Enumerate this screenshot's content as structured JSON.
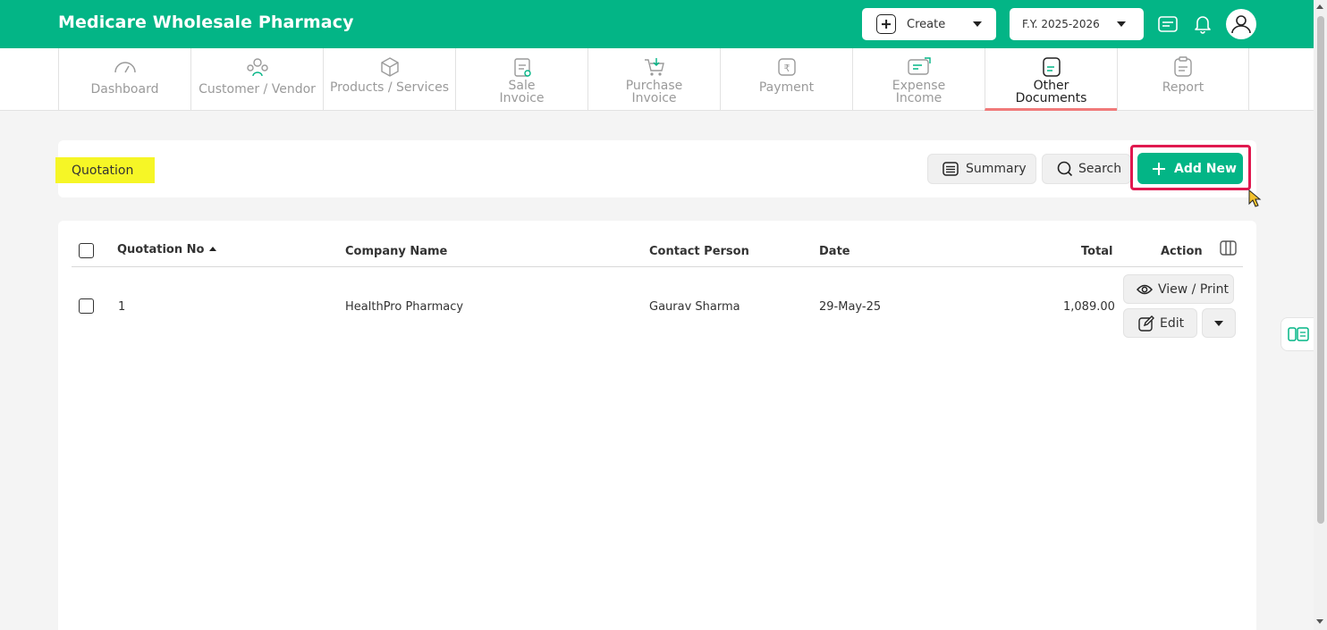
{
  "header": {
    "brand": "Medicare Wholesale Pharmacy",
    "create_label": "Create",
    "fy_label": "F.Y. 2025-2026",
    "icons": [
      "keyboard-icon",
      "bell-icon",
      "user-icon"
    ]
  },
  "nav": {
    "tabs": [
      {
        "label": "Dashboard",
        "icon": "gauge-icon"
      },
      {
        "label": "Customer / Vendor",
        "icon": "users-icon"
      },
      {
        "label": "Products / Services",
        "icon": "box-icon"
      },
      {
        "label": "Sale Invoice",
        "icon": "invoice-icon"
      },
      {
        "label": "Purchase Invoice",
        "icon": "cart-icon"
      },
      {
        "label": "Payment",
        "icon": "rupee-icon"
      },
      {
        "label": "Expense Income",
        "icon": "exchange-icon"
      },
      {
        "label": "Other Documents",
        "icon": "document-icon",
        "active": true
      },
      {
        "label": "Report",
        "icon": "report-icon"
      }
    ]
  },
  "page": {
    "title": "Quotation",
    "summary_label": "Summary",
    "search_label": "Search",
    "add_new_label": "Add New"
  },
  "table": {
    "columns": [
      "Quotation No",
      "Company Name",
      "Contact Person",
      "Date",
      "Total",
      "Action"
    ],
    "rows": [
      {
        "no": "1",
        "company": "HealthPro Pharmacy",
        "contact": "Gaurav Sharma",
        "date": "29-May-25",
        "total": "1,089.00"
      }
    ],
    "actions": {
      "view_print": "View / Print",
      "edit": "Edit"
    }
  },
  "colors": {
    "brand": "#03b586",
    "highlight": "#f6f626",
    "focus_outline": "#e0194f",
    "active_tab_underline": "#f07a7a"
  }
}
